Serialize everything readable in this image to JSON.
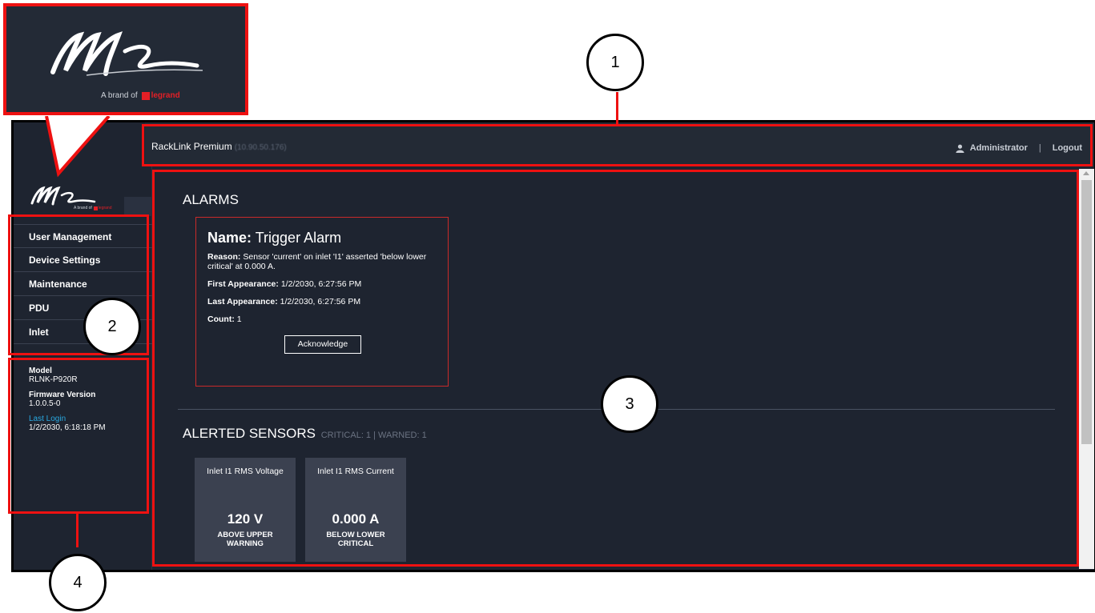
{
  "topbar": {
    "title": "RackLink Premium",
    "ip": "(10.90.50.176)",
    "user": "Administrator",
    "separator": "|",
    "logout": "Logout"
  },
  "logo": {
    "text": "A brand of",
    "brand": "legrand",
    "brand_color": "#e31f26"
  },
  "sidebar": {
    "items": [
      {
        "label": "User Management"
      },
      {
        "label": "Device Settings"
      },
      {
        "label": "Maintenance"
      },
      {
        "label": "PDU"
      },
      {
        "label": "Inlet"
      }
    ],
    "info": {
      "model_label": "Model",
      "model_value": "RLNK-P920R",
      "firmware_label": "Firmware Version",
      "firmware_value": "1.0.0.5-0",
      "last_login_label": "Last Login",
      "last_login_value": "1/2/2030, 6:18:18 PM"
    }
  },
  "main": {
    "alarms_title": "ALARMS",
    "alarm": {
      "name_label": "Name:",
      "name_value": "Trigger Alarm",
      "reason_label": "Reason:",
      "reason_value": "Sensor 'current' on inlet 'I1' asserted 'below lower critical' at 0.000 A.",
      "first_label": "First Appearance:",
      "first_value": "1/2/2030, 6:27:56 PM",
      "last_label": "Last Appearance:",
      "last_value": "1/2/2030, 6:27:56 PM",
      "count_label": "Count:",
      "count_value": "1",
      "ack_label": "Acknowledge"
    },
    "sensors_title": "ALERTED SENSORS",
    "sensors_summary": "CRITICAL: 1 | WARNED: 1",
    "sensors": [
      {
        "name": "Inlet I1 RMS Voltage",
        "value": "120 V",
        "state_line1": "ABOVE UPPER",
        "state_line2": "WARNING"
      },
      {
        "name": "Inlet I1 RMS Current",
        "value": "0.000 A",
        "state_line1": "BELOW LOWER",
        "state_line2": "CRITICAL"
      }
    ]
  },
  "callouts": [
    "1",
    "2",
    "3",
    "4"
  ],
  "colors": {
    "background": "#1e2430",
    "topbar": "#232a35",
    "alarm_border": "#c92a2a",
    "link": "#29a8e0",
    "tile": "#3b4150",
    "annotation_red": "#ee1111"
  }
}
